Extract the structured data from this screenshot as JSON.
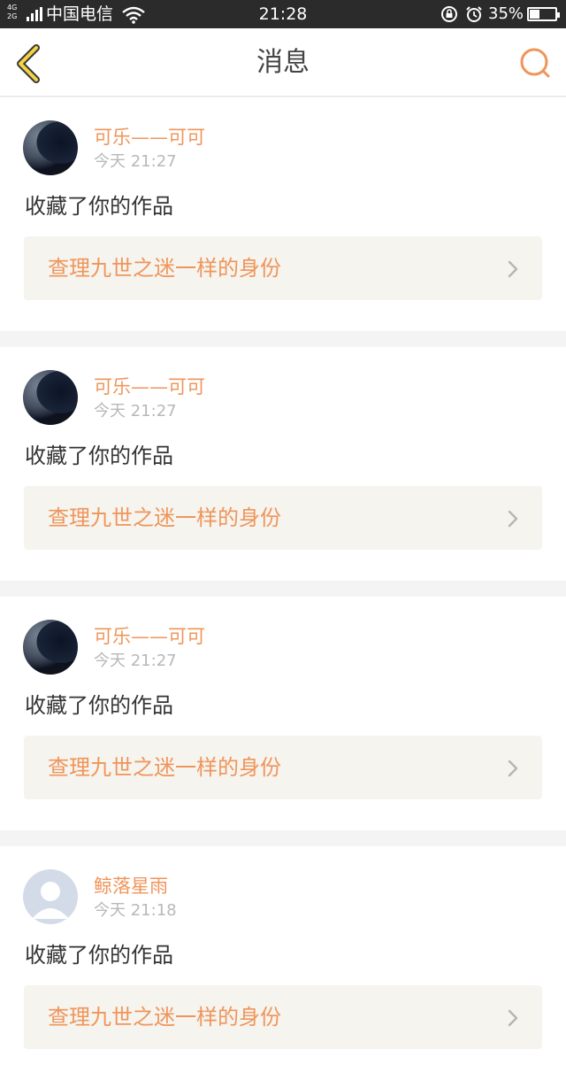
{
  "status_bar": {
    "network_top": "4G",
    "network_bottom": "2G",
    "carrier": "中国电信",
    "time": "21:28",
    "battery_percent_text": "35%",
    "battery_level": 0.35
  },
  "header": {
    "title": "消息",
    "back_icon": "chevron-left-icon",
    "search_icon": "search-icon",
    "accent_color": "#f0955a",
    "back_color": "#f5d341"
  },
  "messages": [
    {
      "username": "可乐——可可",
      "time": "今天 21:27",
      "action": "收藏了你的作品",
      "work_title": "查理九世之迷一样的身份",
      "avatar": "photo"
    },
    {
      "username": "可乐——可可",
      "time": "今天 21:27",
      "action": "收藏了你的作品",
      "work_title": "查理九世之迷一样的身份",
      "avatar": "photo"
    },
    {
      "username": "可乐——可可",
      "time": "今天 21:27",
      "action": "收藏了你的作品",
      "work_title": "查理九世之迷一样的身份",
      "avatar": "photo"
    },
    {
      "username": "鲸落星雨",
      "time": "今天 21:18",
      "action": "收藏了你的作品",
      "work_title": "查理九世之迷一样的身份",
      "avatar": "default"
    }
  ]
}
